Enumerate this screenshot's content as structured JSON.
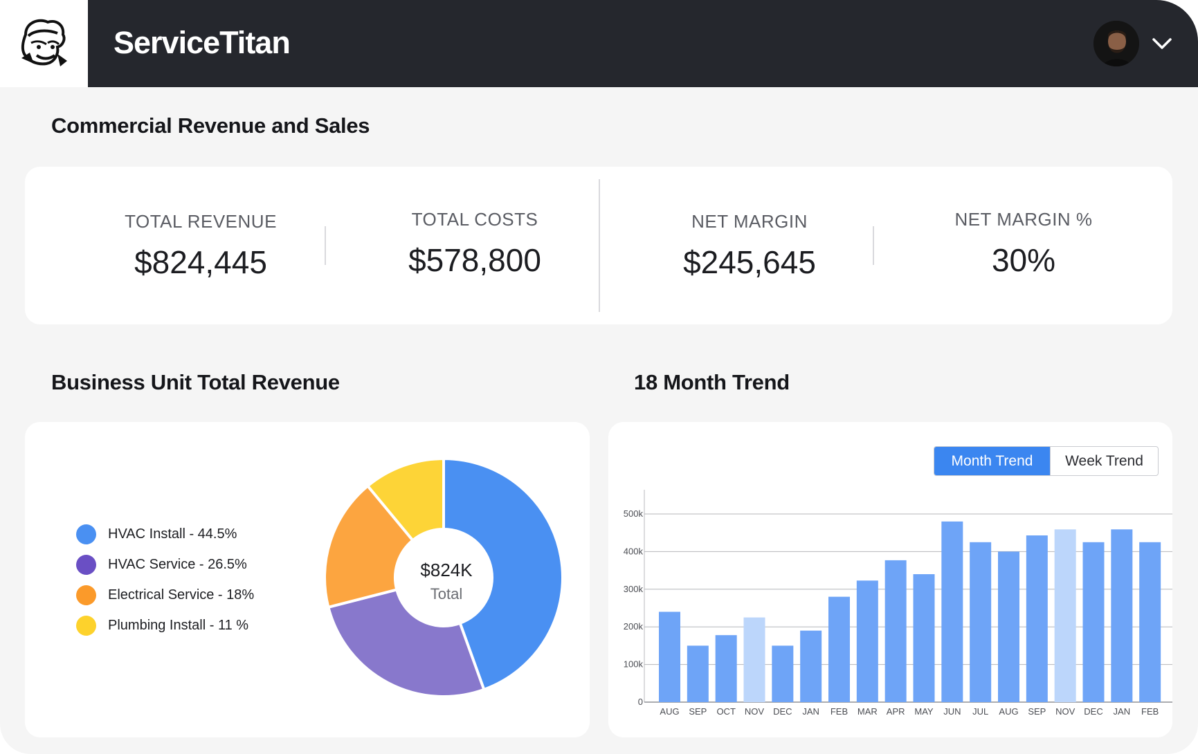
{
  "header": {
    "brand": "ServiceTitan",
    "logo_icon": "titan-mascot-icon",
    "avatar_icon": "user-avatar",
    "menu_icon": "chevron-down-icon"
  },
  "summary": {
    "title": "Commercial Revenue and Sales",
    "kpis": [
      {
        "label": "TOTAL REVENUE",
        "value": "$824,445"
      },
      {
        "label": "TOTAL COSTS",
        "value": "$578,800"
      },
      {
        "label": "NET MARGIN",
        "value": "$245,645"
      },
      {
        "label": "NET MARGIN %",
        "value": "30%"
      }
    ]
  },
  "business_unit": {
    "title": "Business Unit Total Revenue",
    "legend": [
      {
        "label": "HVAC Install - 44.5%",
        "color": "#4a90f2"
      },
      {
        "label": "HVAC Service - 26.5%",
        "color": "#6a4fc4"
      },
      {
        "label": "Electrical Service - 18%",
        "color": "#fb9a2a"
      },
      {
        "label": "Plumbing Install - 11 %",
        "color": "#fdd22c"
      }
    ],
    "center_value": "$824K",
    "center_label": "Total"
  },
  "trend": {
    "title": "18 Month Trend",
    "toggle": {
      "active": "Month Trend",
      "inactive": "Week Trend"
    }
  },
  "chart_data": [
    {
      "type": "pie",
      "title": "",
      "categories": [
        "HVAC Install",
        "HVAC Service",
        "Electrical Service",
        "Plumbing Install"
      ],
      "values": [
        44.5,
        26.5,
        18,
        11
      ],
      "colors": [
        "#4a90f2",
        "#8878cc",
        "#fca540",
        "#fdd437"
      ]
    },
    {
      "type": "bar",
      "title": "",
      "categories": [
        "AUG",
        "SEP",
        "OCT",
        "NOV",
        "DEC",
        "JAN",
        "FEB",
        "MAR",
        "APR",
        "MAY",
        "JUN",
        "JUL",
        "AUG",
        "SEP",
        "NOV",
        "DEC",
        "JAN",
        "FEB"
      ],
      "values": [
        240000,
        150000,
        178000,
        225000,
        150000,
        190000,
        280000,
        323000,
        377000,
        340000,
        480000,
        425000,
        400000,
        443000,
        459000,
        425000,
        459000,
        425000
      ],
      "highlighted": [
        3,
        14
      ],
      "yticks": [
        "0",
        "100k",
        "200k",
        "300k",
        "400k",
        "500k"
      ],
      "ylim": [
        0,
        500000
      ],
      "xlabel": "",
      "ylabel": "",
      "colors": {
        "bar": "#6ea4f7",
        "highlight": "#bcd6fb"
      },
      "grid": true
    }
  ]
}
